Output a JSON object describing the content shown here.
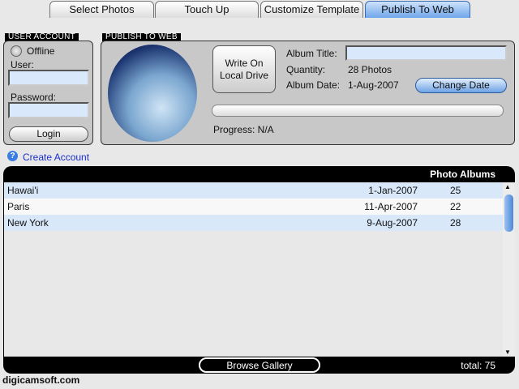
{
  "tabs": [
    "Select Photos",
    "Touch Up",
    "Customize Template",
    "Publish To Web"
  ],
  "user_account": {
    "heading": "USER ACCOUNT",
    "status": "Offline",
    "user_label": "User:",
    "user_value": "",
    "password_label": "Password:",
    "password_value": "",
    "login": "Login",
    "create_account": "Create Account"
  },
  "publish": {
    "heading": "PUBLISH TO WEB",
    "write_button_line1": "Write On",
    "write_button_line2": "Local Drive",
    "album_title_label": "Album Title:",
    "album_title_value": "",
    "quantity_label": "Quantity:",
    "quantity_value": "28 Photos",
    "album_date_label": "Album Date:",
    "album_date_value": "1-Aug-2007",
    "change_date": "Change Date",
    "progress_text": "Progress: N/A",
    "progress_fraction": 0
  },
  "albums": {
    "heading": "Photo Albums",
    "rows": [
      {
        "name": "Hawai'i",
        "date": "1-Jan-2007",
        "count": "25"
      },
      {
        "name": "Paris",
        "date": "11-Apr-2007",
        "count": "22"
      },
      {
        "name": "New York",
        "date": "9-Aug-2007",
        "count": "28"
      }
    ],
    "browse": "Browse Gallery",
    "total": "total: 75"
  },
  "footer": "digicamsoft.com"
}
